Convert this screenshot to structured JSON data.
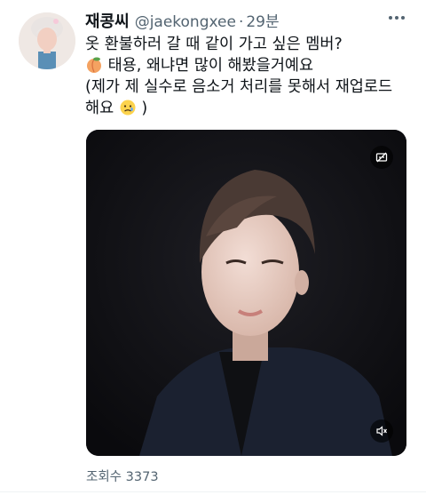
{
  "tweet": {
    "display_name": "재콩씨",
    "handle": "@jaekongxee",
    "separator": "·",
    "time": "29분",
    "text_line1": "옷 환불하러 갈 때 같이 가고 싶은 멤버?",
    "text_line2": "태용, 왜냐면 많이 해봤을거예요",
    "text_line3": "(제가 제 실수로 음소거 처리를 못해서 재업로드",
    "text_line4": "해요",
    "text_line4_end": ")",
    "views_label": "조회수",
    "views_count": "3373"
  },
  "icons": {
    "more": "more-horizontal-icon",
    "emoji_line2": "peach-emoji",
    "emoji_line4": "crying-face-emoji",
    "caption": "captions-off-icon",
    "mute": "volume-muted-icon"
  },
  "colors": {
    "text_primary": "#0f1419",
    "text_secondary": "#536471",
    "media_bg": "#101014"
  }
}
